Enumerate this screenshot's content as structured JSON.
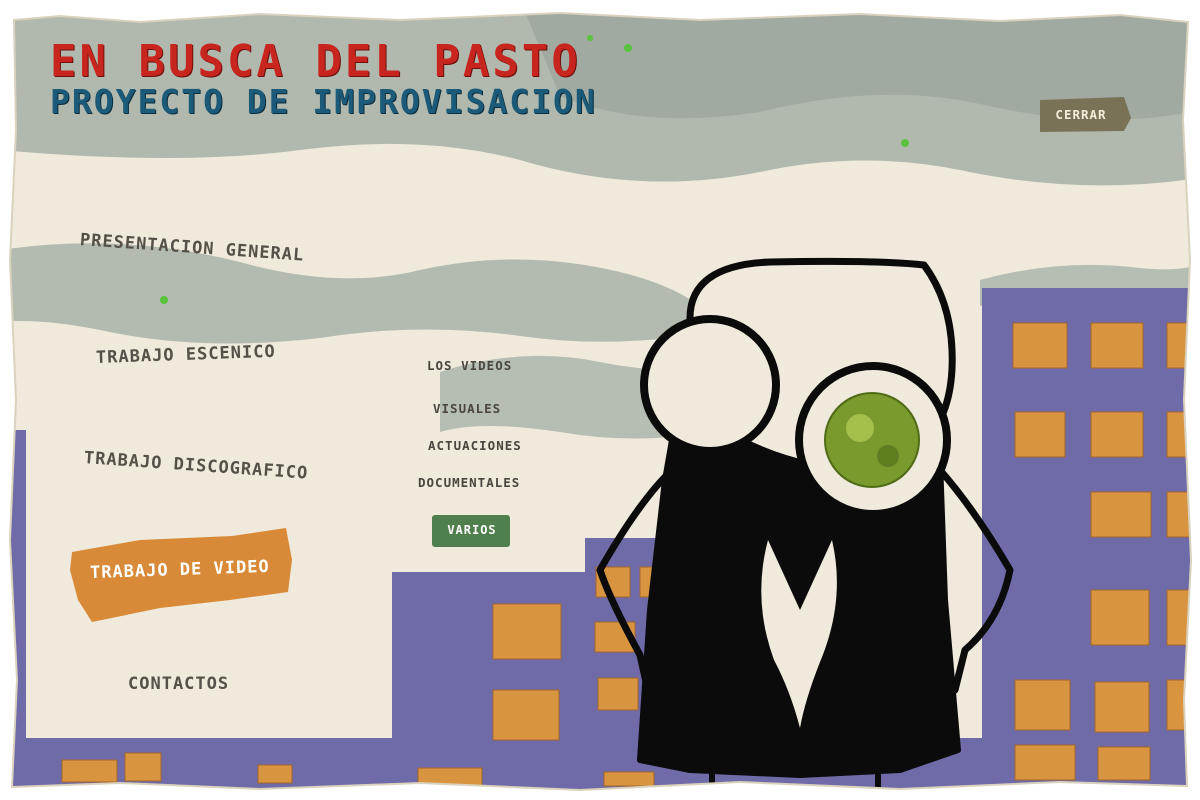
{
  "header": {
    "title": "EN BUSCA DEL PASTO",
    "subtitle": "PROYECTO DE IMPROVISACION"
  },
  "close_button": {
    "label": "CERRAR"
  },
  "menu": {
    "items": [
      {
        "label": "PRESENTACION GENERAL",
        "active": false
      },
      {
        "label": "TRABAJO ESCENICO",
        "active": false
      },
      {
        "label": "TRABAJO DISCOGRAFICO",
        "active": false
      },
      {
        "label": "TRABAJO DE VIDEO",
        "active": true
      },
      {
        "label": "CONTACTOS",
        "active": false
      }
    ]
  },
  "submenu": {
    "items": [
      {
        "label": "LOS VIDEOS",
        "active": false
      },
      {
        "label": "VISUALES",
        "active": false
      },
      {
        "label": "ACTUACIONES",
        "active": false
      },
      {
        "label": "DOCUMENTALES",
        "active": false
      },
      {
        "label": "VARIOS",
        "active": true
      }
    ]
  },
  "colors": {
    "title_red": "#c8251e",
    "subtitle_blue": "#1b5a78",
    "active_orange": "#d98a38",
    "active_green": "#4f7f4c",
    "building_purple": "#6f6aa8",
    "window_orange": "#d9943f",
    "paper": "#efeadb",
    "cloud_grey": "#aeb5ad"
  }
}
